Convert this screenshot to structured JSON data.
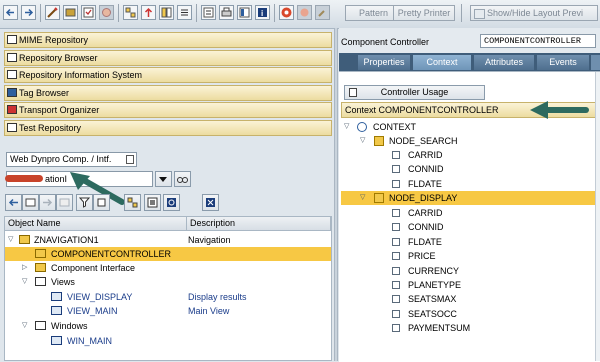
{
  "toolbar": {
    "pattern_label": "Pattern",
    "pretty_printer_label": "Pretty Printer",
    "show_hide_label": "Show/Hide Layout Previ"
  },
  "left": {
    "nav_items": [
      {
        "label": "MIME Repository",
        "icon": "mime-icon"
      },
      {
        "label": "Repository Browser",
        "icon": "repository-browser-icon"
      },
      {
        "label": "Repository Information System",
        "icon": "info-system-icon"
      },
      {
        "label": "Tag Browser",
        "icon": "tag-browser-icon"
      },
      {
        "label": "Transport Organizer",
        "icon": "truck-icon"
      },
      {
        "label": "Test Repository",
        "icon": "test-repository-icon"
      }
    ],
    "object_type": "Web Dynpro Comp. / Intf.",
    "object_name": "ationI",
    "tree_headers": {
      "object_name": "Object Name",
      "description": "Description"
    },
    "tree_rows": [
      {
        "name": "ZNAVIGATION1",
        "desc": "Navigation"
      },
      {
        "name": "COMPONENTCONTROLLER",
        "desc": ""
      },
      {
        "name": "Component Interface",
        "desc": ""
      },
      {
        "name": "Views",
        "desc": ""
      },
      {
        "name": "VIEW_DISPLAY",
        "desc": "Display results"
      },
      {
        "name": "VIEW_MAIN",
        "desc": "Main View"
      },
      {
        "name": "Windows",
        "desc": ""
      },
      {
        "name": "WIN_MAIN",
        "desc": ""
      }
    ]
  },
  "right": {
    "component_label": "Component Controller",
    "component_value": "COMPONENTCONTROLLER",
    "tabs": [
      "Properties",
      "Context",
      "Attributes",
      "Events"
    ],
    "controller_usage": "Controller Usage",
    "context_title": "Context COMPONENTCONTROLLER",
    "context_root": "CONTEXT",
    "node1": "NODE_SEARCH",
    "node1_attrs": [
      "CARRID",
      "CONNID",
      "FLDATE"
    ],
    "node2": "NODE_DISPLAY",
    "node2_attrs": [
      "CARRID",
      "CONNID",
      "FLDATE",
      "PRICE",
      "CURRENCY",
      "PLANETYPE",
      "SEATSMAX",
      "SEATSOCC",
      "PAYMENTSUM"
    ]
  },
  "colors": {
    "selection": "#f7c844",
    "tab_active": "#8fb3d3",
    "nav_bar": "#ecdca0",
    "arrow": "#2d6a5f"
  }
}
